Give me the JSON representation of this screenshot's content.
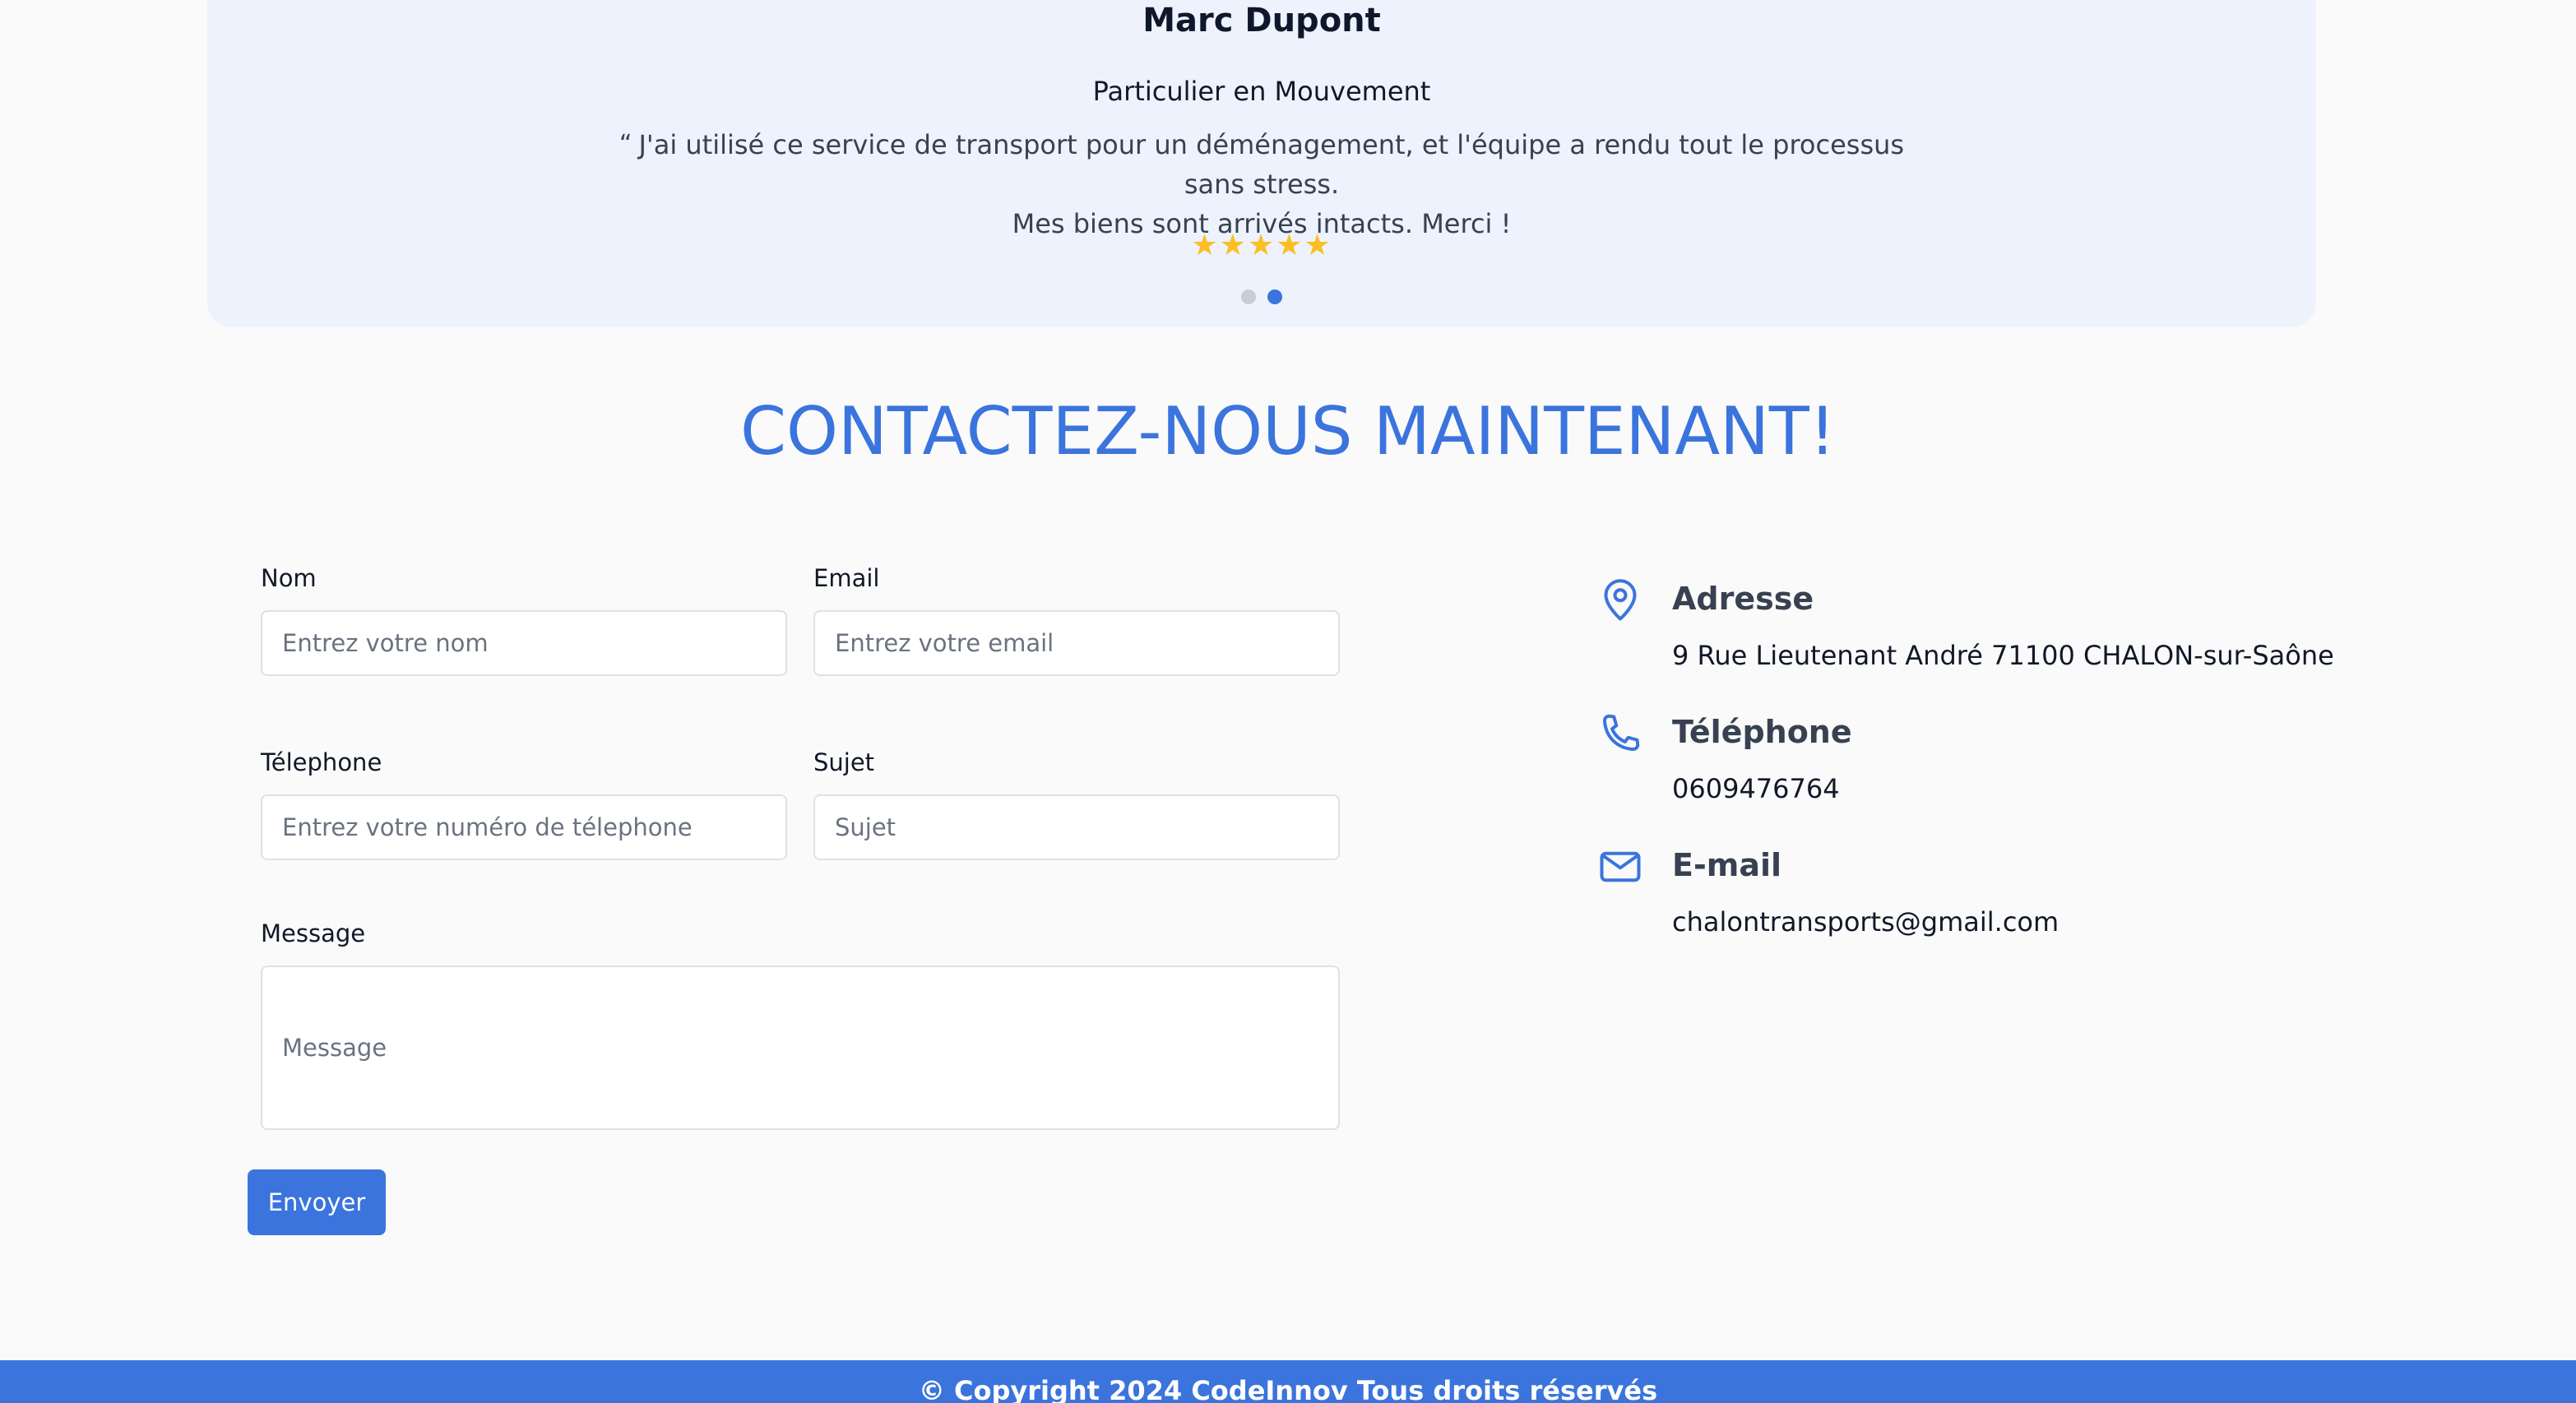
{
  "testimonial": {
    "name": "Marc Dupont",
    "role": "Particulier en Mouvement",
    "quote_mark": "“",
    "quote_line1": "J'ai utilisé ce service de transport pour un déménagement, et l'équipe a rendu tout le processus sans stress.",
    "quote_line2": "Mes biens sont arrivés intacts. Merci !",
    "stars": "★★★★★",
    "rating": 5,
    "carousel": {
      "total": 2,
      "active": 2
    }
  },
  "contact": {
    "title": "CONTACTEZ-NOUS MAINTENANT!",
    "form": {
      "nom_label": "Nom",
      "nom_placeholder": "Entrez votre nom",
      "email_label": "Email",
      "email_placeholder": "Entrez votre email",
      "telephone_label": "Télephone",
      "telephone_placeholder": "Entrez votre numéro de télephone",
      "sujet_label": "Sujet",
      "sujet_placeholder": "Sujet",
      "message_label": "Message",
      "message_placeholder": "Message",
      "submit_label": "Envoyer"
    },
    "info": {
      "address_title": "Adresse",
      "address_value": "9 Rue Lieutenant André 71100 CHALON-sur-Saône",
      "address_icon": "map-pin-icon",
      "phone_title": "Téléphone",
      "phone_value": "0609476764",
      "phone_icon": "phone-icon",
      "email_title": "E-mail",
      "email_value": "chalontransports@gmail.com",
      "email_icon": "mail-icon"
    }
  },
  "footer": {
    "copyright": "© Copyright 2024 CodeInnov Tous droits réservés"
  },
  "colors": {
    "accent": "#3b74dc",
    "card_bg": "#edf2fc",
    "star": "#fbbf24"
  }
}
